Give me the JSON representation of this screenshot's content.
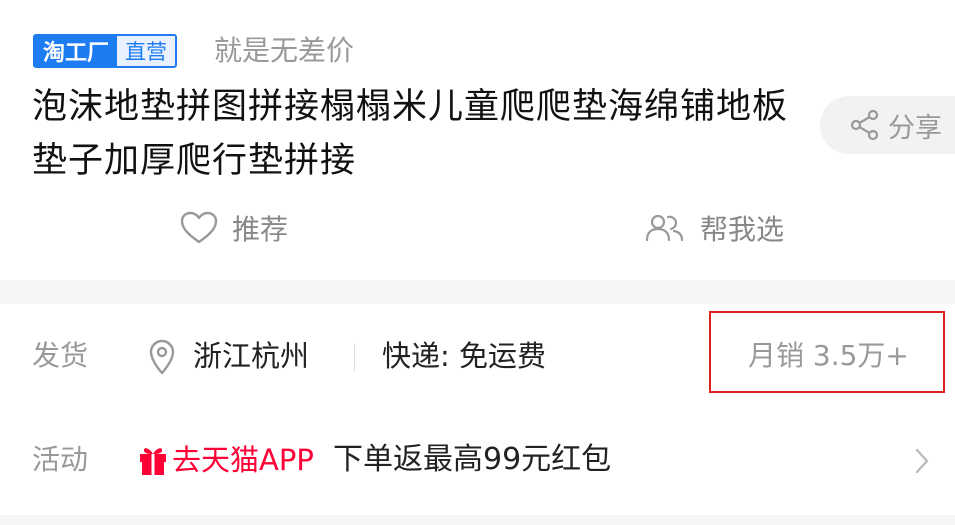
{
  "header": {
    "badge_brand": "淘工厂",
    "badge_type": "直营",
    "slogan": "就是无差价"
  },
  "product": {
    "title": "泡沫地垫拼图拼接榻榻米儿童爬爬垫海绵铺地板垫子加厚爬行垫拼接"
  },
  "share": {
    "label": "分享",
    "icon": "share-icon"
  },
  "actions": {
    "recommend_label": "推荐",
    "recommend_icon": "heart-icon",
    "help_choose_label": "帮我选",
    "help_choose_icon": "users-icon"
  },
  "shipping": {
    "label": "发货",
    "location": "浙江杭州",
    "location_icon": "location-pin-icon",
    "express": "快递: 免运费",
    "monthly_sales": "月销 3.5万+"
  },
  "promotion": {
    "label": "活动",
    "link_icon": "gift-icon",
    "link_text": "去天猫APP",
    "text": "下单返最高99元红包"
  },
  "colors": {
    "brand_blue": "#1e7cf2",
    "tmall_red": "#ff0036",
    "highlight_red": "#e02020"
  }
}
